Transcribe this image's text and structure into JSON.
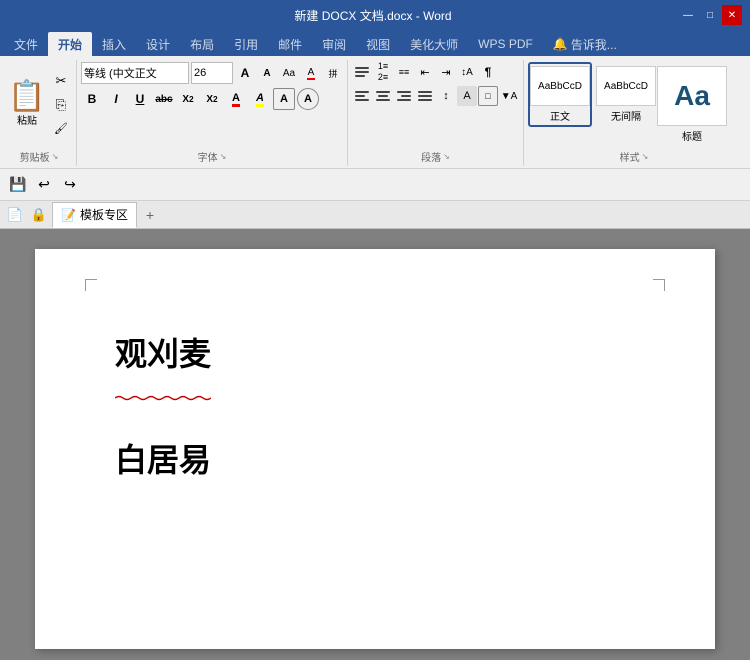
{
  "titlebar": {
    "title": "新建 DOCX 文档.docx - Word",
    "controls": [
      "—",
      "□",
      "✕"
    ]
  },
  "ribbon": {
    "tabs": [
      "文件",
      "开始",
      "插入",
      "设计",
      "布局",
      "引用",
      "邮件",
      "审阅",
      "视图",
      "美化大师",
      "WPS PDF",
      "🔔 告诉我..."
    ],
    "active_tab": "开始",
    "groups": {
      "clipboard": {
        "label": "剪贴板",
        "paste": "粘贴",
        "cut": "✂",
        "copy": "⎘",
        "format": "🖌"
      },
      "font": {
        "label": "字体",
        "font_name": "等线 (中文正文",
        "font_size": "26",
        "grow": "A",
        "shrink": "A",
        "case": "Aa",
        "clear": "A",
        "bold": "B",
        "italic": "I",
        "underline": "U",
        "strikethrough": "abc",
        "subscript": "X₂",
        "superscript": "X²",
        "color_a": "A",
        "highlight": "A",
        "border_a": "A",
        "circle_a": "A"
      },
      "paragraph": {
        "label": "段落",
        "expand_label": "↘"
      },
      "styles": {
        "label": "样式",
        "items": [
          {
            "name": "正文",
            "preview": "AaBbCcD"
          },
          {
            "name": "无间隔",
            "preview": "AaBbCcD"
          },
          {
            "name": "标题",
            "preview": "Aa"
          }
        ]
      }
    }
  },
  "quick_toolbar": {
    "save": "💾",
    "undo": "↩",
    "redo": "↪"
  },
  "tab_bar": {
    "home_icon": "🏠",
    "lock_icon": "🔒",
    "template_label": "模板专区",
    "add": "+"
  },
  "document": {
    "title": "观刈麦",
    "author": "白居易"
  }
}
